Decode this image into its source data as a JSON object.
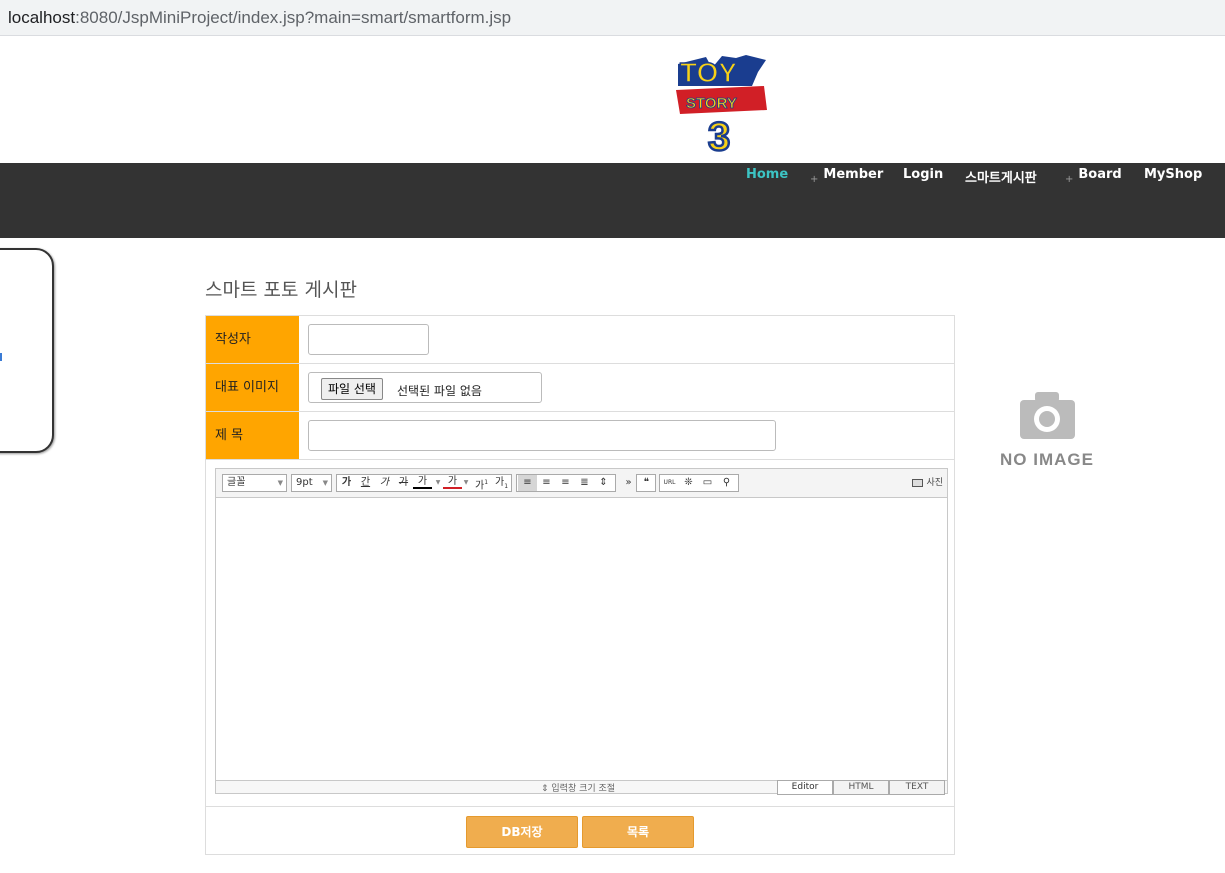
{
  "browser": {
    "url_host": "localhost",
    "url_rest": ":8080/JspMiniProject/index.jsp?main=smart/smartform.jsp"
  },
  "header": {
    "logo_icon": "toy-story-3-logo",
    "logo_lines": [
      "TOY",
      "STORY",
      "3"
    ]
  },
  "nav": {
    "items": [
      {
        "label": "Home",
        "plus": ""
      },
      {
        "label": "Member",
        "plus": "+"
      },
      {
        "label": "Login",
        "plus": ""
      },
      {
        "label": "스마트게시판",
        "plus": ""
      },
      {
        "label": "Board",
        "plus": "+"
      },
      {
        "label": "MyShop",
        "plus": ""
      }
    ],
    "active_color": "#3cc4c4",
    "bg_color": "#333333"
  },
  "page": {
    "title": "스마트 포토 게시판"
  },
  "form": {
    "writer_label": "작성자",
    "writer_value": "",
    "image_label": "대표 이미지",
    "file_button": "파일 선택",
    "file_status": "선택된 파일 없음",
    "subject_label": "제 목",
    "subject_value": "",
    "label_color": "#ffa500"
  },
  "editor": {
    "font_select": "글꼴",
    "size_select": "9pt",
    "format_buttons": [
      "가",
      "간",
      "가",
      "가",
      "가",
      "가",
      "가",
      "가"
    ],
    "photo_button": "사진",
    "resize_label": "입력창 크기 조절",
    "mode_tabs": [
      "Editor",
      "HTML",
      "TEXT"
    ],
    "active_mode": "Editor"
  },
  "actions": {
    "save_label": "DB저장",
    "list_label": "목록",
    "button_color": "#f0ad4e"
  },
  "preview": {
    "icon": "camera-icon",
    "text": "NO IMAGE"
  }
}
